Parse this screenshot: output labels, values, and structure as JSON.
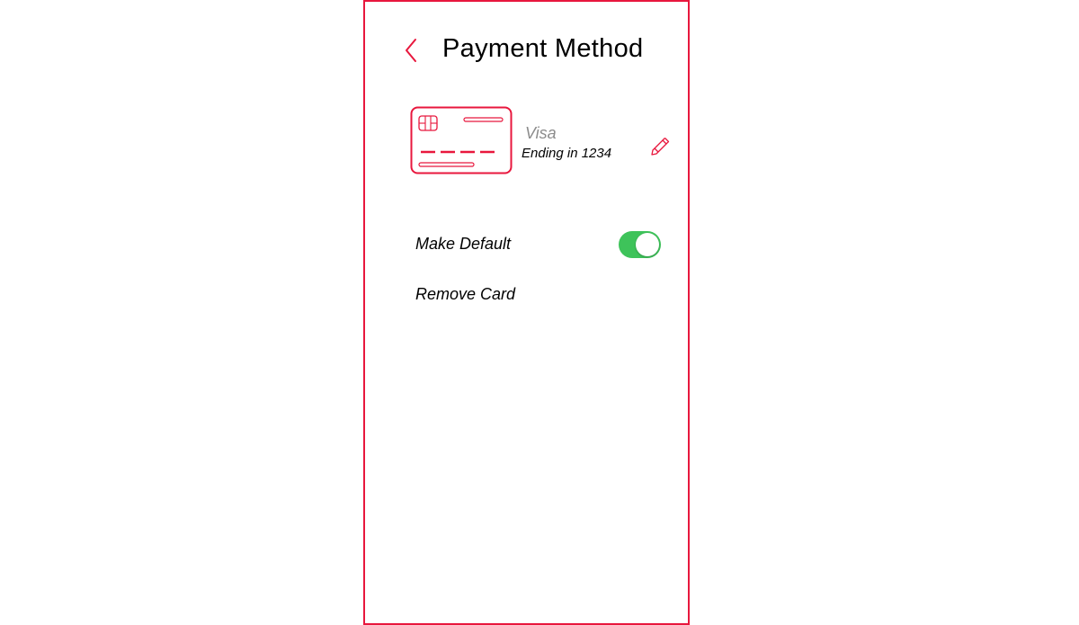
{
  "header": {
    "title": "Payment Method",
    "back_icon": "chevron-left-icon"
  },
  "card": {
    "brand": "Visa",
    "ending": "Ending in 1234",
    "illustration_icon": "credit-card-icon",
    "edit_icon": "pencil-icon"
  },
  "options": {
    "make_default_label": "Make Default",
    "make_default_enabled": true,
    "remove_card_label": "Remove Card"
  },
  "colors": {
    "accent": "#e8173d",
    "toggle_on": "#3ec35a",
    "muted_text": "#8c8c8c"
  }
}
